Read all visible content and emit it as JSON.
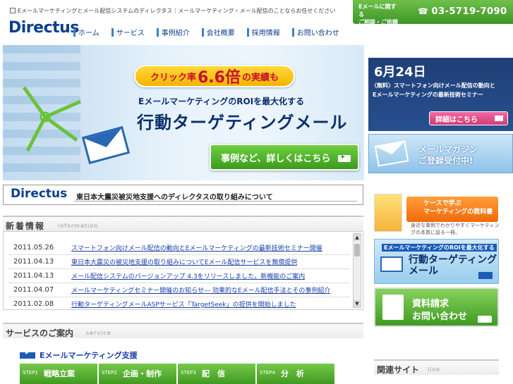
{
  "header": {
    "tagline": "Eメールマーケティングとメール配信システムのディレクタス｜メールマーケティング・メール配信のことならお任せください",
    "logo": "Directus",
    "nav": [
      {
        "label": "ホーム"
      },
      {
        "label": "サービス"
      },
      {
        "label": "事例紹介"
      },
      {
        "label": "会社概要"
      },
      {
        "label": "採用情報"
      },
      {
        "label": "お問い合わせ"
      }
    ],
    "contact": {
      "line1": "Eメールに関する",
      "line2": "ご相談・ご依頼は",
      "phone": "03-5719-7090",
      "phone_icon": "phone-icon"
    }
  },
  "hero": {
    "badge_pre": "クリック率",
    "badge_big": "6.6倍",
    "badge_post": "の実績も",
    "subtitle": "EメールマーケティングのROIを最大化する",
    "title": "行動ターゲティングメール",
    "cta": "事例など、詳しくはこちら"
  },
  "quake": {
    "logo": "Directus",
    "text": "東日本大震災被災地支援へのディレクタスの取り組みについて"
  },
  "news": {
    "title": "新着情報",
    "title_en": "information",
    "items": [
      {
        "date": "2011.05.26",
        "text": "スマートフォン向けメール配信の動向とEメールマーケティングの最新技術セミナー開催"
      },
      {
        "date": "2011.04.13",
        "text": "東日本大震災の被災地支援の取り組みについてEメール配信サービスを無償提供"
      },
      {
        "date": "2011.04.13",
        "text": "メール配信システムのバージョンアップ 4.3をリリースしました。新機能のご案内"
      },
      {
        "date": "2011.04.07",
        "text": "メールマーケティングセミナー開催のお知らせ— 効果的なEメール配信手法とその事例紹介"
      },
      {
        "date": "2011.02.08",
        "text": "行動ターゲティングメールASPサービス「TargetSeek」の提供を開始しました"
      }
    ]
  },
  "services": {
    "title": "サービスのご案内",
    "title_en": "service",
    "link": "Eメールマーケティング支援",
    "steps": [
      {
        "num": "STEP1",
        "label": "戦略立案"
      },
      {
        "num": "STEP2",
        "label": "企画・制作"
      },
      {
        "num": "STEP3",
        "label": "配　信"
      },
      {
        "num": "STEP4",
        "label": "分　析"
      }
    ]
  },
  "sidebar": {
    "event": {
      "date": "6月24日",
      "line1": "〈無料〉スマートフォン向けメール配信の動向と",
      "line2": "Eメールマーケティングの最新技術セミナー",
      "button": "詳細はこちら"
    },
    "magazine": {
      "line1": "メールマガジン",
      "line2": "ご登録受付中!"
    },
    "book": {
      "title_line1": "ケースで学ぶ",
      "title_line2": "マーケティングの教科書",
      "desc": "身近な事例でわかりやすくマーケティングの本質に迫る一冊。"
    },
    "banner2": {
      "sub": "EメールマーケティングのROIを最大化する",
      "line1": "行動ターゲティング",
      "line2": "メール"
    },
    "request": {
      "line1": "資料請求",
      "line2": "お問い合わせ"
    },
    "related": {
      "title": "関連サイト",
      "title_en": "link"
    }
  }
}
